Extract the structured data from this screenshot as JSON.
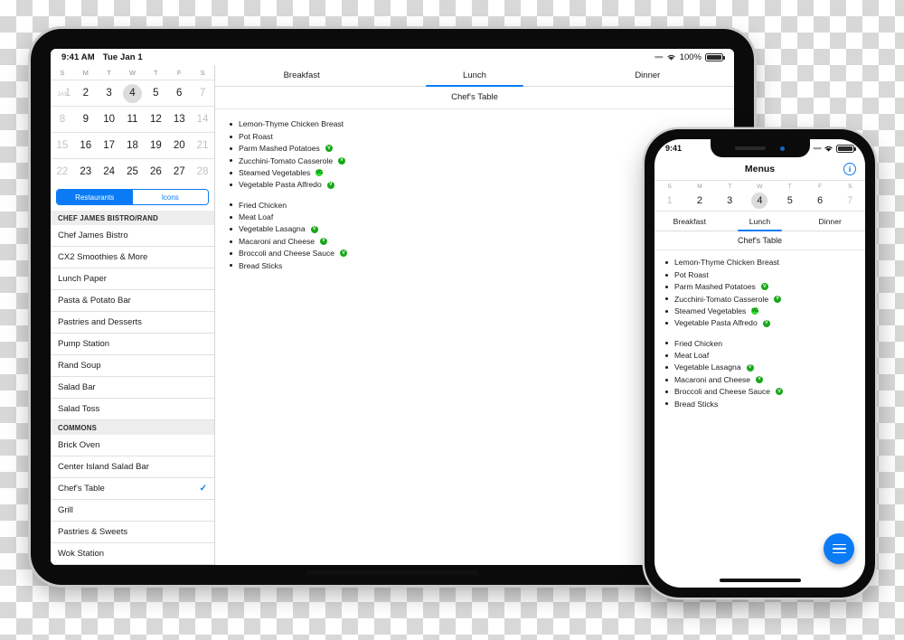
{
  "tablet": {
    "status_bar": {
      "time": "9:41 AM",
      "date": "Tue Jan 1",
      "battery_percent": "100%",
      "wifi_icon": "wifi-icon",
      "battery_icon": "battery-icon",
      "signal_icon": "signal-dots-icon"
    },
    "calendar": {
      "weekday_labels": [
        "S",
        "M",
        "T",
        "W",
        "T",
        "F",
        "S"
      ],
      "month_tag": "JAN",
      "weeks": [
        [
          {
            "d": "1",
            "dim": true
          },
          {
            "d": "2"
          },
          {
            "d": "3"
          },
          {
            "d": "4",
            "sel": true
          },
          {
            "d": "5"
          },
          {
            "d": "6"
          },
          {
            "d": "7",
            "dim": true
          }
        ],
        [
          {
            "d": "8",
            "dim": true
          },
          {
            "d": "9"
          },
          {
            "d": "10"
          },
          {
            "d": "11"
          },
          {
            "d": "12"
          },
          {
            "d": "13"
          },
          {
            "d": "14",
            "dim": true
          }
        ],
        [
          {
            "d": "15",
            "dim": true
          },
          {
            "d": "16"
          },
          {
            "d": "17"
          },
          {
            "d": "18"
          },
          {
            "d": "19"
          },
          {
            "d": "20"
          },
          {
            "d": "21",
            "dim": true
          }
        ],
        [
          {
            "d": "22",
            "dim": true
          },
          {
            "d": "23"
          },
          {
            "d": "24"
          },
          {
            "d": "25"
          },
          {
            "d": "26"
          },
          {
            "d": "27"
          },
          {
            "d": "28",
            "dim": true
          }
        ]
      ]
    },
    "segmented": {
      "options": [
        "Restaurants",
        "Icons"
      ],
      "selected": "Restaurants"
    },
    "restaurant_list": [
      {
        "type": "header",
        "label": "CHEF JAMES BISTRO/RAND"
      },
      {
        "type": "item",
        "label": "Chef James Bistro"
      },
      {
        "type": "item",
        "label": "CX2 Smoothies & More"
      },
      {
        "type": "item",
        "label": "Lunch Paper"
      },
      {
        "type": "item",
        "label": "Pasta & Potato Bar"
      },
      {
        "type": "item",
        "label": "Pastries and Desserts"
      },
      {
        "type": "item",
        "label": "Pump Station"
      },
      {
        "type": "item",
        "label": "Rand Soup"
      },
      {
        "type": "item",
        "label": "Salad Bar"
      },
      {
        "type": "item",
        "label": "Salad Toss"
      },
      {
        "type": "header",
        "label": "COMMONS"
      },
      {
        "type": "item",
        "label": "Brick Oven"
      },
      {
        "type": "item",
        "label": "Center Island Salad Bar"
      },
      {
        "type": "item",
        "label": "Chef's Table",
        "checked": true,
        "check_icon": "checkmark-icon"
      },
      {
        "type": "item",
        "label": "Grill"
      },
      {
        "type": "item",
        "label": "Pastries & Sweets"
      },
      {
        "type": "item",
        "label": "Wok Station"
      }
    ],
    "meal_tabs": {
      "items": [
        "Breakfast",
        "Lunch",
        "Dinner"
      ],
      "selected": "Lunch"
    },
    "venue_title": "Chef's Table",
    "menu_groups": [
      {
        "items": [
          {
            "name": "Lemon-Thyme Chicken Breast"
          },
          {
            "name": "Pot Roast"
          },
          {
            "name": "Parm Mashed Potatoes",
            "badge": "V"
          },
          {
            "name": "Zucchini-Tomato Casserole",
            "badge": "V"
          },
          {
            "name": "Steamed Vegetables",
            "badge": "VG"
          },
          {
            "name": "Vegetable Pasta Alfredo",
            "badge": "V"
          }
        ]
      },
      {
        "items": [
          {
            "name": "Fried Chicken"
          },
          {
            "name": "Meat Loaf"
          },
          {
            "name": "Vegetable Lasagna",
            "badge": "V"
          },
          {
            "name": "Macaroni and Cheese",
            "badge": "V"
          },
          {
            "name": "Broccoli and Cheese Sauce",
            "badge": "V"
          },
          {
            "name": "Bread Sticks"
          }
        ]
      }
    ]
  },
  "phone": {
    "status_bar": {
      "time": "9:41",
      "wifi_icon": "wifi-icon",
      "battery_icon": "battery-icon",
      "signal_icon": "signal-dots-icon"
    },
    "navbar": {
      "title": "Menus",
      "info_icon": "info-circle-icon"
    },
    "calendar": {
      "weekday_labels": [
        "S",
        "M",
        "T",
        "W",
        "T",
        "F",
        "S"
      ],
      "days": [
        {
          "d": "1",
          "dim": true
        },
        {
          "d": "2"
        },
        {
          "d": "3"
        },
        {
          "d": "4",
          "sel": true
        },
        {
          "d": "5"
        },
        {
          "d": "6"
        },
        {
          "d": "7",
          "dim": true
        }
      ]
    },
    "meal_tabs": {
      "items": [
        "Breakfast",
        "Lunch",
        "Dinner"
      ],
      "selected": "Lunch"
    },
    "venue_title": "Chef's Table",
    "menu_groups": [
      {
        "items": [
          {
            "name": "Lemon-Thyme Chicken Breast"
          },
          {
            "name": "Pot Roast"
          },
          {
            "name": "Parm Mashed Potatoes",
            "badge": "V"
          },
          {
            "name": "Zucchini-Tomato Casserole",
            "badge": "V"
          },
          {
            "name": "Steamed Vegetables",
            "badge": "VG"
          },
          {
            "name": "Vegetable Pasta Alfredo",
            "badge": "V"
          }
        ]
      },
      {
        "items": [
          {
            "name": "Fried Chicken"
          },
          {
            "name": "Meat Loaf"
          },
          {
            "name": "Vegetable Lasagna",
            "badge": "V"
          },
          {
            "name": "Macaroni and Cheese",
            "badge": "V"
          },
          {
            "name": "Broccoli and Cheese Sauce",
            "badge": "V"
          },
          {
            "name": "Bread Sticks"
          }
        ]
      }
    ],
    "fab": {
      "icon": "hamburger-menu-icon"
    }
  },
  "colors": {
    "accent": "#0a7bf5",
    "veg_badge": "#18a818",
    "vegan_badge": "#2ddb2d",
    "selected_day": "#dcdcdc"
  }
}
